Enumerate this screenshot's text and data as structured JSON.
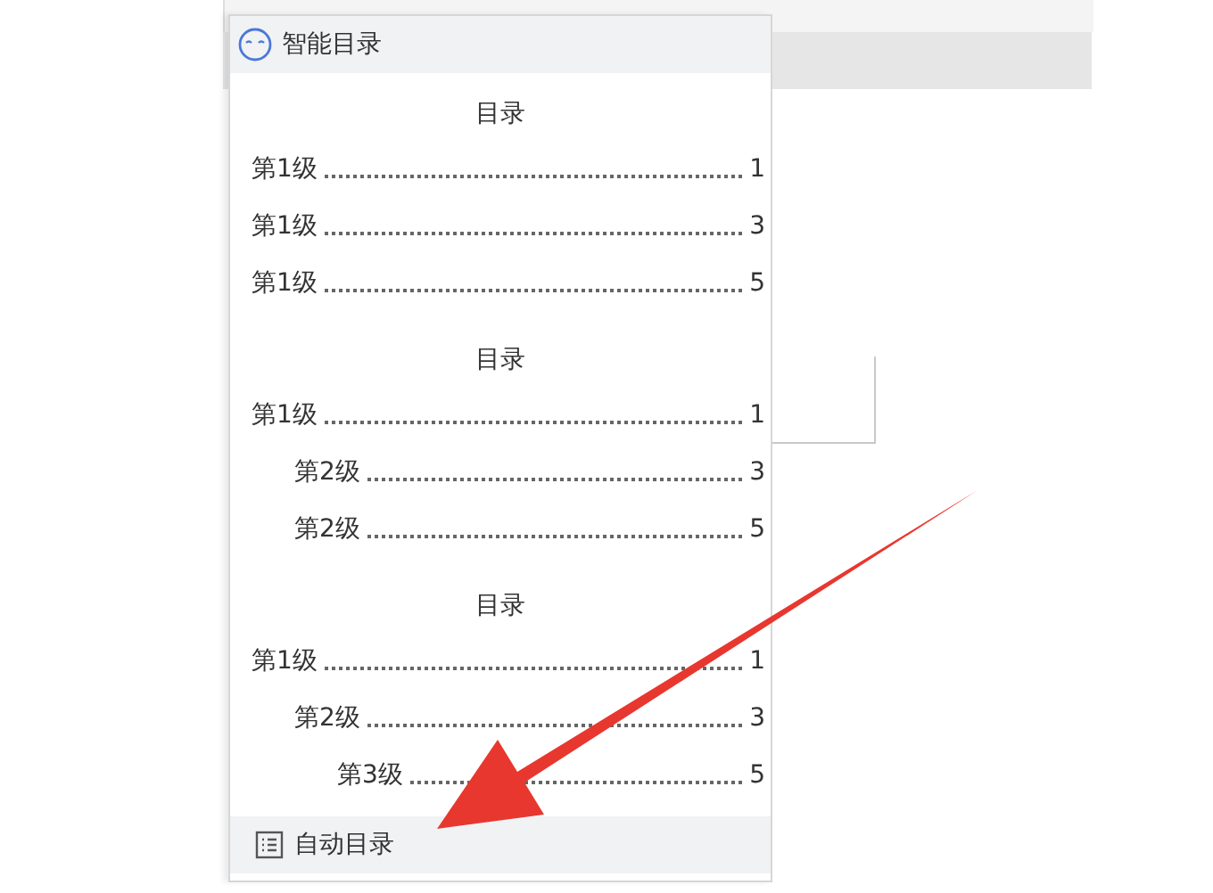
{
  "menu": {
    "title": "智能目录",
    "templates": [
      {
        "heading": "目录",
        "entries": [
          {
            "label": "第1级",
            "page": "1"
          },
          {
            "label": "第1级",
            "page": "3"
          },
          {
            "label": "第1级",
            "page": "5"
          }
        ]
      },
      {
        "heading": "目录",
        "entries": [
          {
            "label": "第1级",
            "page": "1",
            "children": [
              {
                "label": "第2级",
                "page": "3"
              },
              {
                "label": "第2级",
                "page": "5"
              }
            ]
          }
        ]
      },
      {
        "heading": "目录",
        "entries": [
          {
            "label": "第1级",
            "page": "1",
            "children": [
              {
                "label": "第2级",
                "page": "3",
                "children": [
                  {
                    "label": "第3级",
                    "page": "5"
                  }
                ]
              }
            ]
          }
        ]
      }
    ],
    "footer_item": {
      "label": "自动目录"
    }
  }
}
